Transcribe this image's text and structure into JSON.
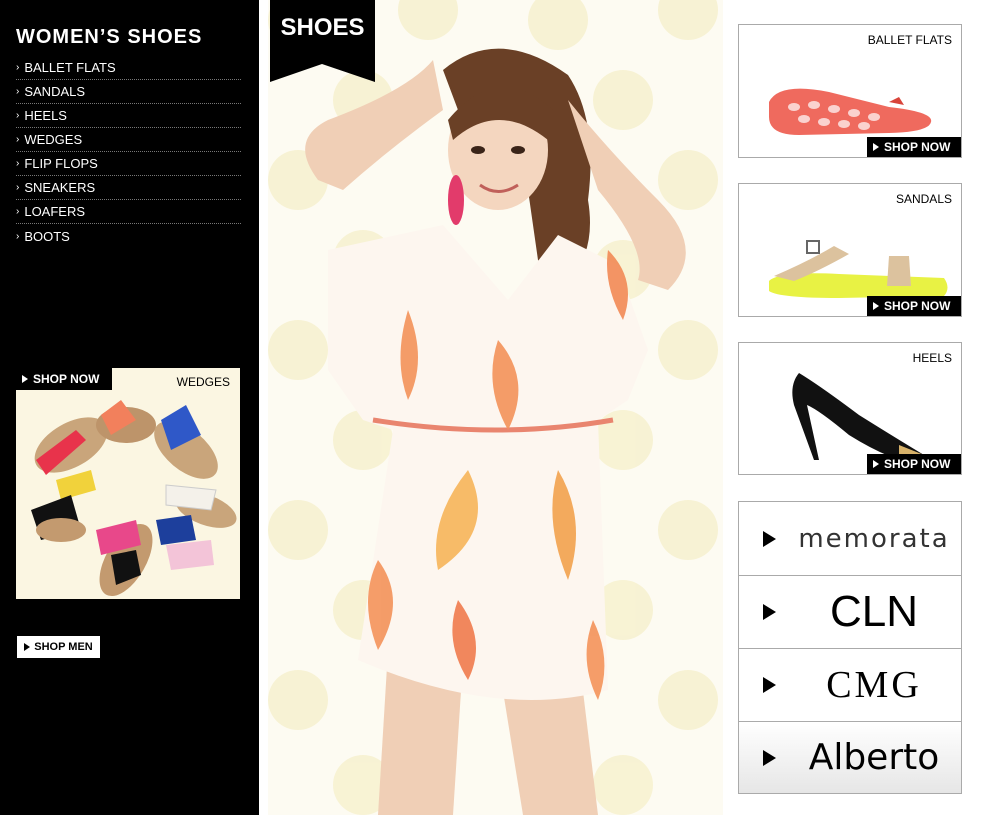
{
  "sidebar": {
    "title": "WOMEN’S SHOES",
    "chevron": "›",
    "items": [
      {
        "label": "BALLET FLATS"
      },
      {
        "label": "SANDALS"
      },
      {
        "label": "HEELS"
      },
      {
        "label": "WEDGES"
      },
      {
        "label": "FLIP FLOPS"
      },
      {
        "label": "SNEAKERS"
      },
      {
        "label": "LOAFERS"
      },
      {
        "label": "BOOTS"
      }
    ],
    "promo": {
      "shop_label": "SHOP NOW",
      "category_label": "WEDGES"
    },
    "shop_men_label": "SHOP MEN"
  },
  "hero": {
    "tag_label": "SHOES"
  },
  "products": [
    {
      "category": "BALLET FLATS",
      "shop_label": "SHOP NOW",
      "color": "#ef6a5e"
    },
    {
      "category": "SANDALS",
      "shop_label": "SHOP NOW",
      "color": "#dcc29e"
    },
    {
      "category": "HEELS",
      "shop_label": "SHOP NOW",
      "color": "#000000"
    }
  ],
  "brands": [
    {
      "name": "memorata"
    },
    {
      "name": "CLN"
    },
    {
      "name": "CMG"
    },
    {
      "name": "Alberto"
    }
  ],
  "colors": {
    "sidebar_bg": "#000000",
    "hero_bg": "#fdfbf2",
    "dot": "#f6efc9",
    "accent_coral": "#f27a4a"
  }
}
